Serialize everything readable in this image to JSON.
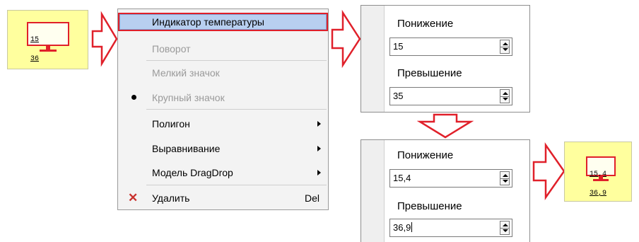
{
  "indicator_before": {
    "low": "15",
    "high": "36"
  },
  "indicator_after": {
    "low": "15,4",
    "high": "36,9"
  },
  "menu": {
    "items": [
      {
        "label": "Индикатор температуры",
        "state": "highlighted"
      },
      {
        "label": "Поворот",
        "state": "disabled"
      },
      {
        "label": "Мелкий значок",
        "state": "disabled"
      },
      {
        "label": "Крупный значок",
        "state": "disabled",
        "checked": true
      },
      {
        "label": "Полигон",
        "submenu": true
      },
      {
        "label": "Выравнивание",
        "submenu": true
      },
      {
        "label": "Модель DragDrop",
        "submenu": true
      },
      {
        "label": "Удалить",
        "shortcut": "Del",
        "icon": "close-icon"
      }
    ]
  },
  "panel_top": {
    "low_label": "Понижение",
    "low_value": "15",
    "high_label": "Превышение",
    "high_value": "35"
  },
  "panel_bottom": {
    "low_label": "Понижение",
    "low_value": "15,4",
    "high_label": "Превышение",
    "high_value": "36,9"
  },
  "colors": {
    "accent": "#e0202a",
    "card": "#ffff9e",
    "highlight": "#b8cff0"
  }
}
